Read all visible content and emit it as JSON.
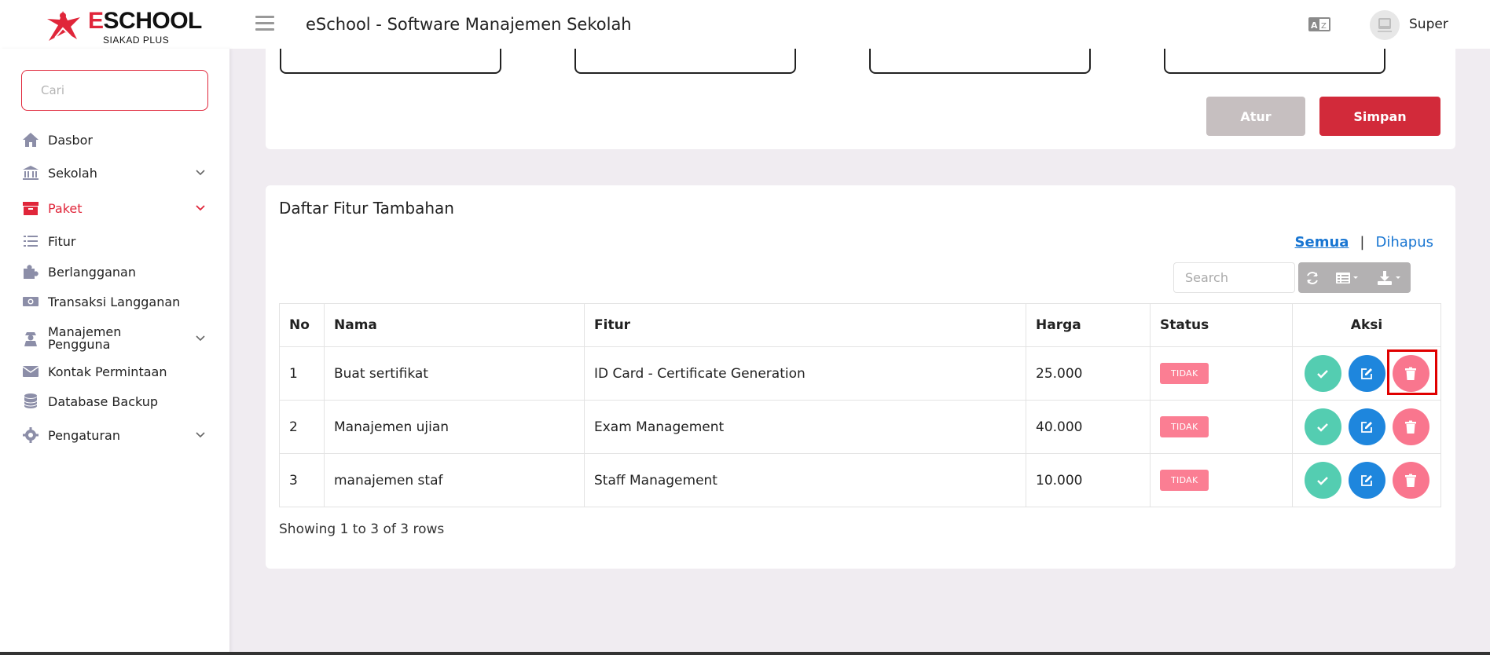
{
  "header": {
    "logo_text": "ESCHOOL",
    "logo_first_letter": "E",
    "logo_rest": "SCHOOL",
    "logo_sub": "SIAKAD PLUS",
    "app_title": "eSchool - Software Manajemen Sekolah",
    "user_name": "Super"
  },
  "sidebar": {
    "search_placeholder": "Cari",
    "items": [
      {
        "label": "Dasbor",
        "icon": "home-icon"
      },
      {
        "label": "Sekolah",
        "icon": "building-icon"
      },
      {
        "label": "Paket",
        "icon": "archive-icon"
      },
      {
        "label": "Fitur",
        "icon": "list-icon"
      },
      {
        "label": "Berlangganan",
        "icon": "puzzle-icon"
      },
      {
        "label": "Transaksi Langganan",
        "icon": "money-icon"
      },
      {
        "label": "Manajemen Pengguna",
        "line1": "Manajemen",
        "line2": "Pengguna",
        "icon": "user-secret-icon"
      },
      {
        "label": "Kontak Permintaan",
        "icon": "envelope-icon"
      },
      {
        "label": "Database Backup",
        "icon": "database-icon"
      },
      {
        "label": "Pengaturan",
        "icon": "gear-icon"
      }
    ]
  },
  "top_card": {
    "atur_label": "Atur",
    "simpan_label": "Simpan"
  },
  "main_card": {
    "title": "Daftar Fitur Tambahan",
    "filter_all": "Semua",
    "filter_sep": "|",
    "filter_deleted": "Dihapus",
    "search_placeholder": "Search",
    "columns": [
      "No",
      "Nama",
      "Fitur",
      "Harga",
      "Status",
      "Aksi"
    ],
    "rows": [
      {
        "no": "1",
        "nama": "Buat sertifikat",
        "fitur": "ID Card - Certificate Generation",
        "harga": "25.000",
        "status": "TIDAK"
      },
      {
        "no": "2",
        "nama": "Manajemen ujian",
        "fitur": "Exam Management",
        "harga": "40.000",
        "status": "TIDAK"
      },
      {
        "no": "3",
        "nama": "manajemen staf",
        "fitur": "Staff Management",
        "harga": "10.000",
        "status": "TIDAK"
      }
    ],
    "footer": "Showing 1 to 3 of 3 rows"
  },
  "colors": {
    "accent": "#e0263a",
    "primary": "#1e86dd",
    "success": "#54cdb1",
    "danger_soft": "#f9768e"
  }
}
